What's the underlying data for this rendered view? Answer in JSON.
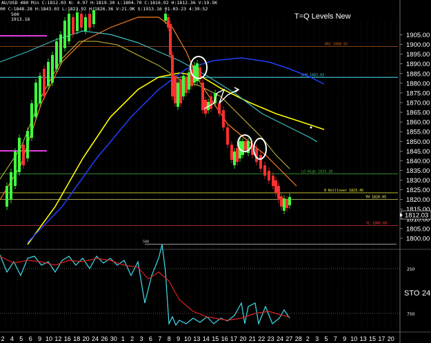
{
  "header": {
    "line1": "AU/USD 480 Min  C:1812.03  N: 4.97  H:1819.30  L:1804.70  C:1816.92  H:1812.36  V:19.5K",
    "line2": "00  C:1848.28  H:1843.03  L:1823.92  H:1826.36  V:21.9K  S:1913.16  01-03-23  4:39:52",
    "row3_a": "500",
    "row3_b": "1913.16"
  },
  "title": "T=Q Levels New",
  "chart_data": {
    "type": "line",
    "ylim": [
      1795,
      1913
    ],
    "y_ticks": [
      1800,
      1805,
      1810,
      1815,
      1820,
      1825,
      1830,
      1835,
      1840,
      1845,
      1850,
      1855,
      1860,
      1865,
      1870,
      1875,
      1880,
      1885,
      1890,
      1895,
      1900,
      1905
    ],
    "last_price_label": "1812.03",
    "last_price": 1812.03,
    "x_ticks": [
      "2",
      "4",
      "5",
      "6",
      "9",
      "10",
      "12",
      "16",
      "18",
      "20",
      "24",
      "26",
      "30",
      "1",
      "2",
      "3",
      "6",
      "7",
      "8",
      "9",
      "10",
      "13",
      "14",
      "15",
      "16",
      "17",
      "20",
      "21",
      "22",
      "23",
      "24",
      "27",
      "28",
      "2",
      "3",
      "5",
      "7",
      "9",
      "10",
      "13",
      "15",
      "17",
      "20"
    ],
    "levels": [
      {
        "label": "DR1  1898.92",
        "value": 1898.92,
        "color": "#d2691e"
      },
      {
        "label": "DH0  1883.03",
        "value": 1883.03,
        "color": "#40c8e0"
      },
      {
        "label": "LO High  1833.28",
        "value": 1833.28,
        "color": "#40c040"
      },
      {
        "label": "0 Rolllover  1823.45",
        "value": 1823.45,
        "color": "#ffff40"
      },
      {
        "label": "YH  1820.05",
        "value": 1820.05,
        "color": "#ffff80"
      },
      {
        "label": "YL  1806.60",
        "value": 1806.6,
        "color": "#ff4040"
      }
    ],
    "marker_500": {
      "label": "500",
      "value": 1797
    }
  },
  "indicator": {
    "label": "STO",
    "value_label": "24",
    "ticks": [
      "250",
      "750"
    ]
  },
  "colors": {
    "up": "#40ff40",
    "down": "#ff3030",
    "ma_yellow": "#ffff00",
    "ma_blue": "#2040ff",
    "ma_cyan": "#40c0c0",
    "ma_orange": "#ff8020",
    "sto_cyan": "#40e0f0",
    "sto_red": "#e02020"
  }
}
